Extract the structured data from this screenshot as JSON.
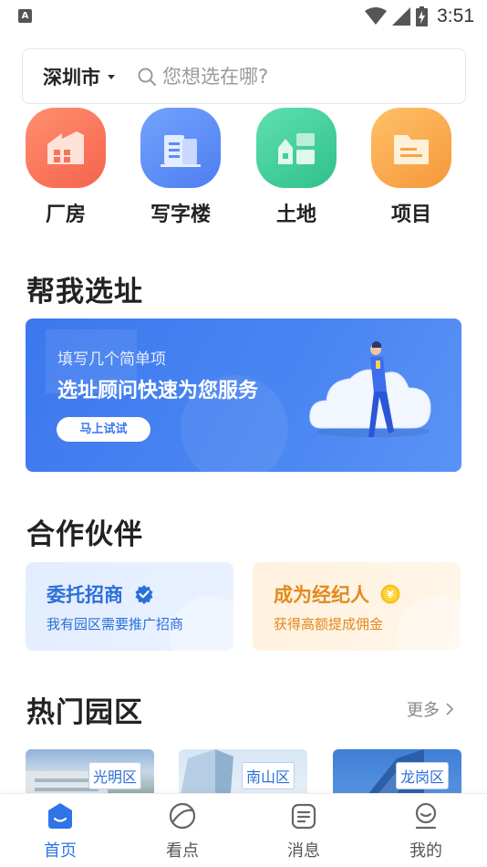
{
  "status_bar": {
    "time": "3:51",
    "app_icon_letter": "A"
  },
  "search": {
    "city": "深圳市",
    "placeholder": "您想选在哪?"
  },
  "categories": [
    {
      "label": "厂房",
      "icon": "factory-icon",
      "color": "#f8735a"
    },
    {
      "label": "写字楼",
      "icon": "office-building-icon",
      "color": "#5c8cf5"
    },
    {
      "label": "土地",
      "icon": "land-icon",
      "color": "#3ecf9a"
    },
    {
      "label": "项目",
      "icon": "project-folder-icon",
      "color": "#f9a443"
    }
  ],
  "site_selection": {
    "title": "帮我选址",
    "banner": {
      "subtitle": "填写几个简单项",
      "headline": "选址顾问快速为您服务",
      "button_label": "马上试试"
    }
  },
  "partners": {
    "title": "合作伙伴",
    "cards": [
      {
        "title": "委托招商",
        "subtitle": "我有园区需要推广招商",
        "badge_icon": "verified-check-icon"
      },
      {
        "title": "成为经纪人",
        "subtitle": "获得高额提成佣金",
        "badge_icon": "yuan-coin-icon"
      }
    ]
  },
  "hot_parks": {
    "title": "热门园区",
    "more_label": "更多",
    "parks": [
      {
        "district": "光明区"
      },
      {
        "district": "南山区"
      },
      {
        "district": "龙岗区"
      }
    ]
  },
  "tabbar": {
    "tabs": [
      {
        "label": "首页",
        "icon": "home-icon",
        "active": true
      },
      {
        "label": "看点",
        "icon": "discover-icon",
        "active": false
      },
      {
        "label": "消息",
        "icon": "message-icon",
        "active": false
      },
      {
        "label": "我的",
        "icon": "profile-icon",
        "active": false
      }
    ]
  },
  "colors": {
    "accent": "#2f74e6",
    "banner_blue": "#3c78ee",
    "partner_blue": "#2b6fd9",
    "partner_orange": "#e28a1d"
  }
}
